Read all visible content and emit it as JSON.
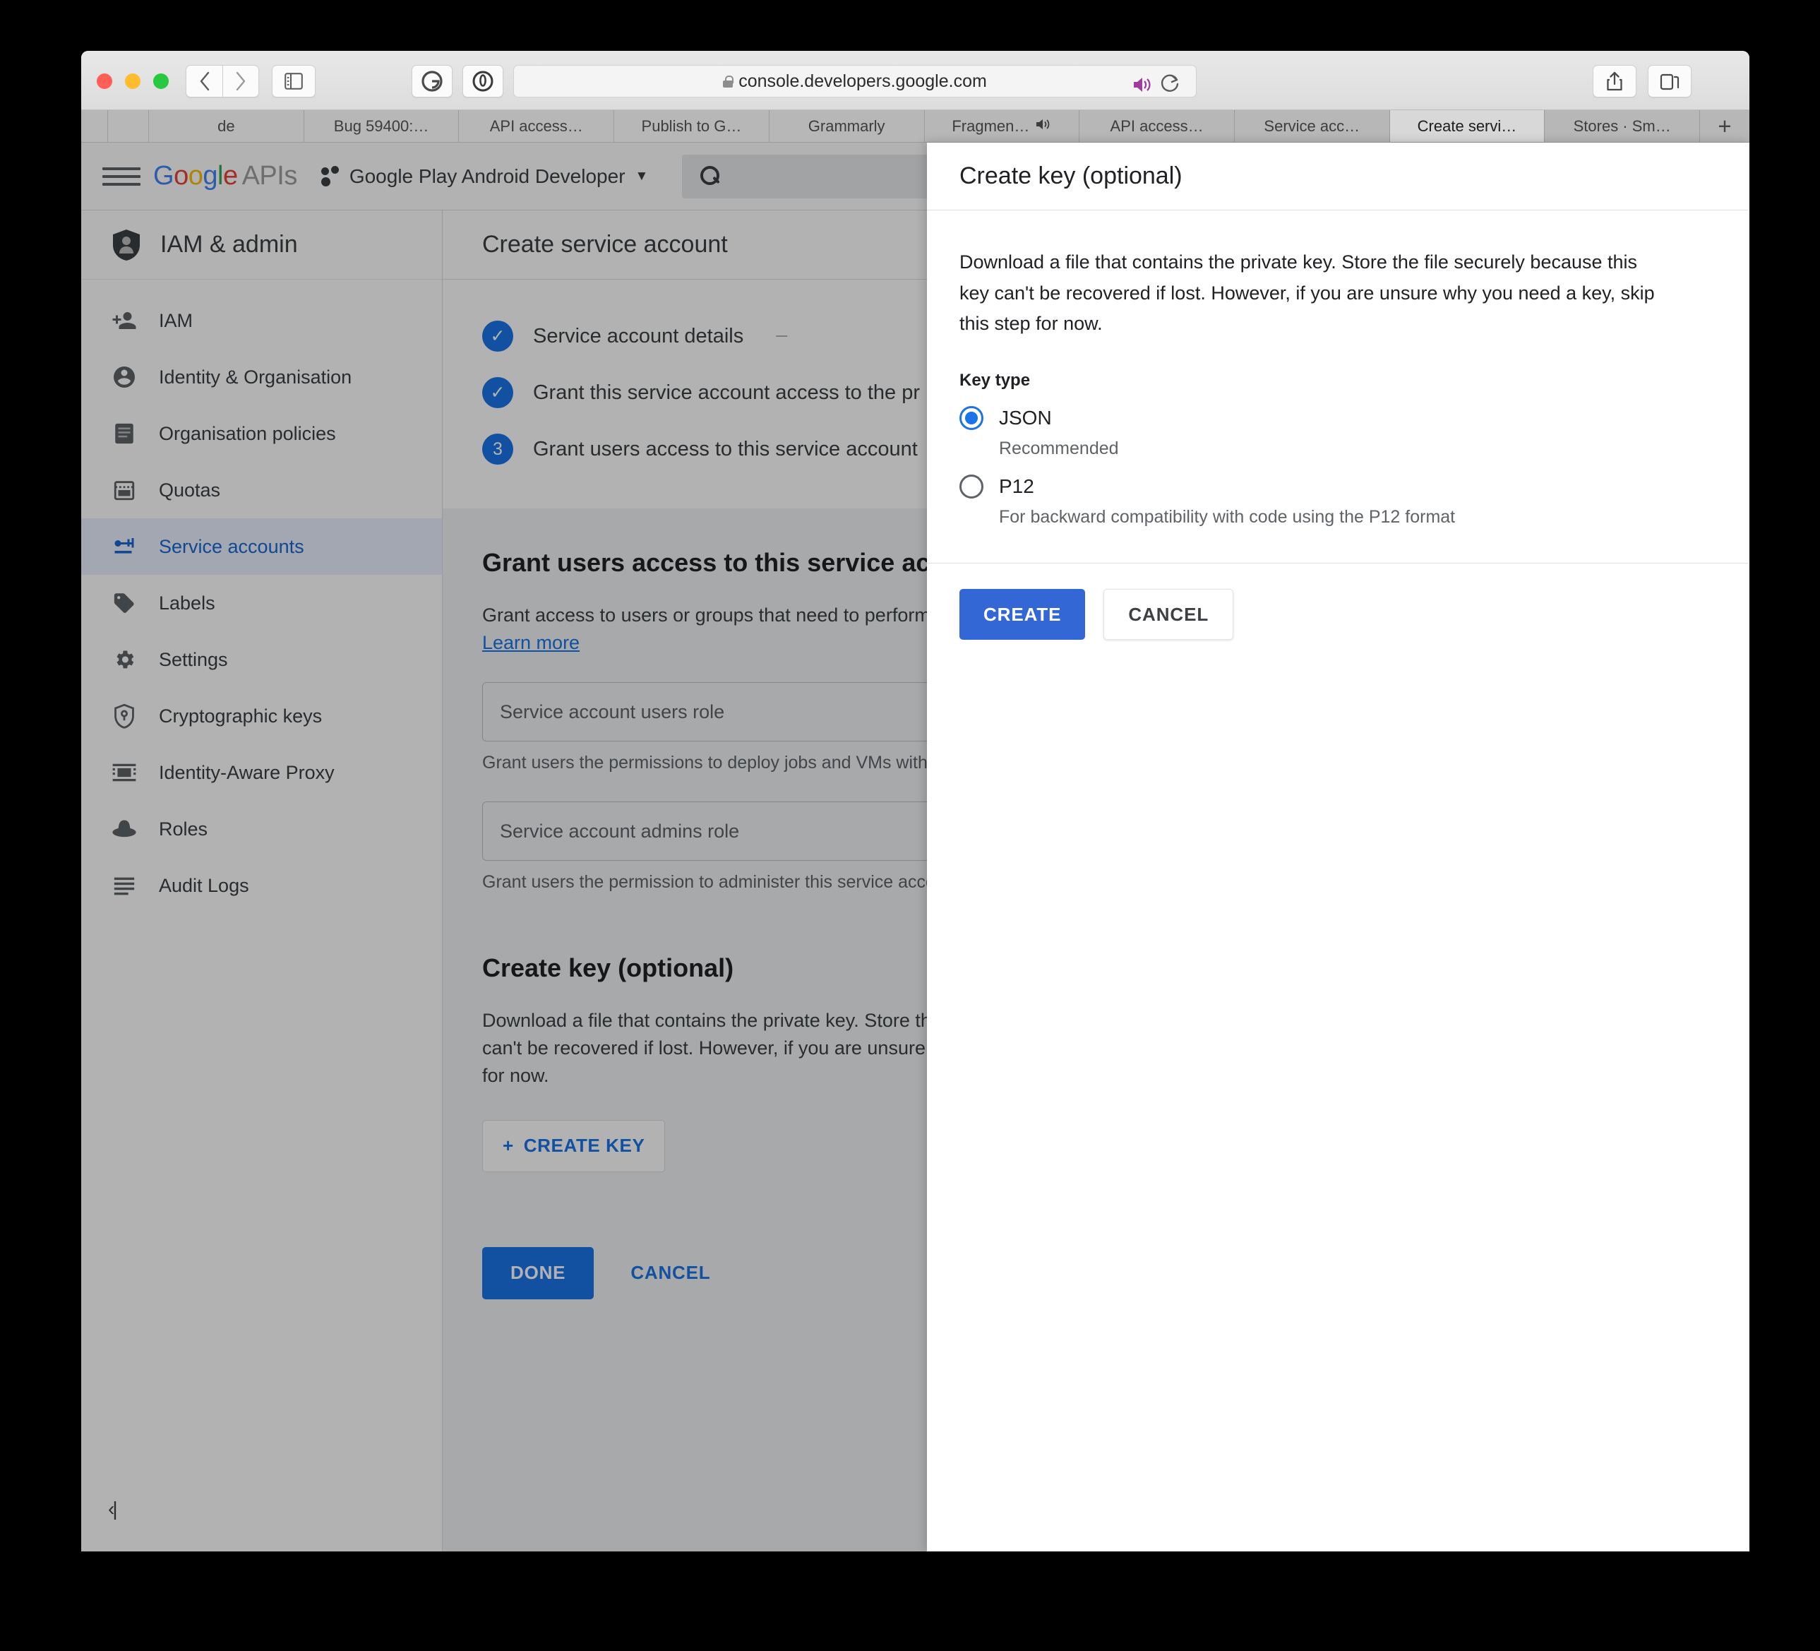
{
  "browser": {
    "url": "console.developers.google.com",
    "lock_icon": "lock-icon",
    "nav_back_icon": "‹",
    "nav_forward_icon": "›",
    "sidebar_toggle_icon": "◫",
    "extension_grammarly_icon": "G",
    "extension_onepassword_icon": "ⓘ",
    "share_icon": "⇧",
    "tabs_icon": "⧉",
    "speaker_icon": "🔊",
    "reload_icon": "↻",
    "newtab_label": "+",
    "tabs": [
      {
        "label": "",
        "muted": false,
        "active": false,
        "narrow": true
      },
      {
        "label": "",
        "muted": false,
        "active": false,
        "narrow2": true
      },
      {
        "label": "de",
        "muted": false,
        "active": false
      },
      {
        "label": "Bug 59400:…",
        "muted": false,
        "active": false
      },
      {
        "label": "API access…",
        "muted": false,
        "active": false
      },
      {
        "label": "Publish to G…",
        "muted": false,
        "active": false
      },
      {
        "label": "Grammarly",
        "muted": false,
        "active": false
      },
      {
        "label": "Fragmen…",
        "muted": true,
        "active": false
      },
      {
        "label": "API access…",
        "muted": false,
        "active": false
      },
      {
        "label": "Service acc…",
        "muted": false,
        "active": false
      },
      {
        "label": "Create servi…",
        "muted": false,
        "active": true
      },
      {
        "label": "Stores · Sm…",
        "muted": false,
        "active": false
      }
    ]
  },
  "header": {
    "menu_icon": "hamburger-icon",
    "brand": {
      "g1": "G",
      "o1": "o",
      "o2": "o",
      "g2": "g",
      "l": "l",
      "e": "e",
      "apis": "APIs"
    },
    "project_name": "Google Play Android Developer",
    "project_caret": "▼",
    "search_placeholder": ""
  },
  "sidebar": {
    "title": "IAM & admin",
    "collapse_icon": "‹|",
    "items": [
      {
        "label": "IAM",
        "icon": "person-add-icon",
        "active": false
      },
      {
        "label": "Identity & Organisation",
        "icon": "account-circle-icon",
        "active": false
      },
      {
        "label": "Organisation policies",
        "icon": "document-icon",
        "active": false
      },
      {
        "label": "Quotas",
        "icon": "quota-icon",
        "active": false
      },
      {
        "label": "Service accounts",
        "icon": "key-card-icon",
        "active": true
      },
      {
        "label": "Labels",
        "icon": "label-icon",
        "active": false
      },
      {
        "label": "Settings",
        "icon": "gear-icon",
        "active": false
      },
      {
        "label": "Cryptographic keys",
        "icon": "shield-key-icon",
        "active": false
      },
      {
        "label": "Identity-Aware Proxy",
        "icon": "proxy-icon",
        "active": false
      },
      {
        "label": "Roles",
        "icon": "hat-icon",
        "active": false
      },
      {
        "label": "Audit Logs",
        "icon": "list-icon",
        "active": false
      }
    ]
  },
  "main": {
    "page_title": "Create service account",
    "steps": [
      {
        "badge": "✓",
        "label": "Service account details",
        "trailing": "—",
        "done": true
      },
      {
        "badge": "✓",
        "label": "Grant this service account access to the pr",
        "trailing": "",
        "done": true
      },
      {
        "badge": "3",
        "label": "Grant users access to this service account",
        "trailing": "",
        "done": false
      }
    ],
    "grant_section": {
      "title": "Grant users access to this service accou",
      "description": "Grant access to users or groups that need to perform ac",
      "learn_more": "Learn more",
      "fields": [
        {
          "placeholder": "Service account users role",
          "help": "Grant users the permissions to deploy jobs and VMs with th"
        },
        {
          "placeholder": "Service account admins role",
          "help": "Grant users the permission to administer this service acco"
        }
      ]
    },
    "create_key_section": {
      "title": "Create key (optional)",
      "description": "Download a file that contains the private key. Store the fi can't be recovered if lost. However, if you are unsure why for now.",
      "description_lines": [
        "Download a file that contains the private key. Store the fi",
        "can't be recovered if lost. However, if you are unsure why",
        "for now."
      ],
      "create_key_button": "CREATE KEY",
      "create_key_plus": "+"
    },
    "done_button": "DONE",
    "cancel_button": "CANCEL"
  },
  "dialog": {
    "title": "Create key (optional)",
    "description": "Download a file that contains the private key. Store the file securely because this key can't be recovered if lost. However, if you are unsure why you need a key, skip this step for now.",
    "key_type_label": "Key type",
    "options": [
      {
        "label": "JSON",
        "sub": "Recommended",
        "selected": true
      },
      {
        "label": "P12",
        "sub": "For backward compatibility with code using the P12 format",
        "selected": false
      }
    ],
    "create_button": "CREATE",
    "cancel_button": "CANCEL"
  },
  "colors": {
    "accent_blue": "#1a73e8",
    "dialog_create_blue": "#3367d6",
    "sidebar_active_bg": "#e8f0fe",
    "page_bg": "#f1f3f4"
  }
}
